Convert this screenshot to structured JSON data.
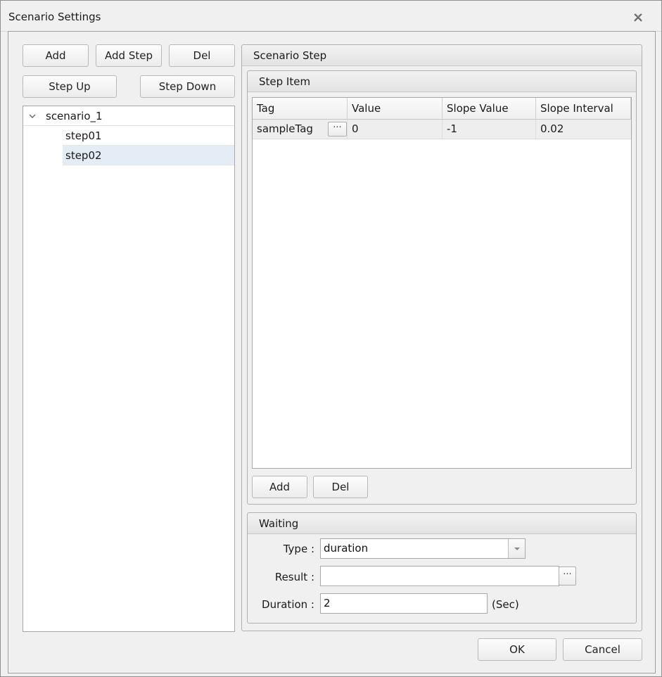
{
  "window": {
    "title": "Scenario Settings",
    "close_icon": "close-icon"
  },
  "left_toolbar": {
    "add": "Add",
    "add_step": "Add Step",
    "del": "Del",
    "step_up": "Step Up",
    "step_down": "Step Down"
  },
  "tree": {
    "root": {
      "label": "scenario_1",
      "expanded": true
    },
    "children": [
      {
        "label": "step01",
        "selected": false
      },
      {
        "label": "step02",
        "selected": true
      }
    ]
  },
  "scenario_step": {
    "title": "Scenario Step",
    "step_item": {
      "title": "Step Item",
      "columns": [
        "Tag",
        "Value",
        "Slope Value",
        "Slope Interval"
      ],
      "rows": [
        {
          "tag": "sampleTag",
          "value": "0",
          "slope_value": "-1",
          "slope_interval": "0.02"
        }
      ],
      "ellipsis": "···",
      "add": "Add",
      "del": "Del"
    },
    "waiting": {
      "title": "Waiting",
      "type_label": "Type :",
      "type_value": "duration",
      "result_label": "Result :",
      "result_value": "",
      "duration_label": "Duration :",
      "duration_value": "2",
      "duration_unit": "(Sec)"
    }
  },
  "footer": {
    "ok": "OK",
    "cancel": "Cancel"
  },
  "colors": {
    "dialog_bg": "#f0f0f0",
    "selection": "#e4ecf6",
    "border": "#a8a8a8"
  }
}
